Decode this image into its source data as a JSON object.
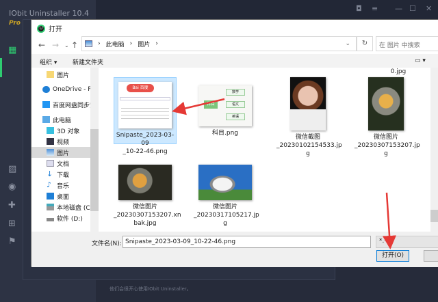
{
  "app": {
    "title": "IObit Uninstaller 10.4",
    "edition": "Pro",
    "footer": "他们会很开心使用IObit Uninstaller。"
  },
  "dialog": {
    "title": "打开",
    "breadcrumb": [
      "此电脑",
      "图片"
    ],
    "search_placeholder": "在 图片 中搜索",
    "toolbar": {
      "organize": "组织 ▾",
      "new_folder": "新建文件夹"
    },
    "nav": [
      "图片",
      "OneDrive - Personal",
      "百度网盘同步空间",
      "此电脑",
      "3D 对象",
      "视频",
      "图片",
      "文档",
      "下载",
      "音乐",
      "桌面",
      "本地磁盘 (C:)",
      "软件 (D:)"
    ],
    "selected_nav": "图片",
    "files": [
      {
        "name": "0.jpg"
      },
      {
        "name": "Snipaste_2023-03-09_10-22-46.png",
        "line1": "Snipaste_2023-03-09",
        "line2": "_10-22-46.png",
        "selected": true
      },
      {
        "name": "科目.png",
        "line1": "科目.png",
        "line2": "",
        "mindmap": {
          "root": "科目",
          "children": [
            "数学",
            "语文",
            "英语"
          ]
        },
        "logo": "Bai 百度"
      },
      {
        "name": "微信截图_20230102154533.jpg",
        "line1": "微信截图",
        "line2": "_20230102154533.jp",
        "line3": "g"
      },
      {
        "name": "微信图片_20230307153207.jpg",
        "line1": "微信图片",
        "line2": "_20230307153207.jp",
        "line3": "g"
      },
      {
        "name": "微信图片_20230307153207.xnbak.jpg",
        "line1": "微信图片",
        "line2": "_20230307153207.xn",
        "line3": "bak.jpg"
      },
      {
        "name": "微信图片_20230317105217.jpg",
        "line1": "微信图片",
        "line2": "_20230317105217.jp",
        "line3": "g"
      }
    ],
    "filename_label": "文件名(N):",
    "filename_value": "Snipaste_2023-03-09_10-22-46.png",
    "filter_value": "*.*",
    "open_button": "打开(O)"
  },
  "colors": {
    "accent": "#0078d7",
    "annotation_arrow": "#e53935",
    "app_bg": "#262b3a",
    "brand_green": "#2ecc71"
  }
}
